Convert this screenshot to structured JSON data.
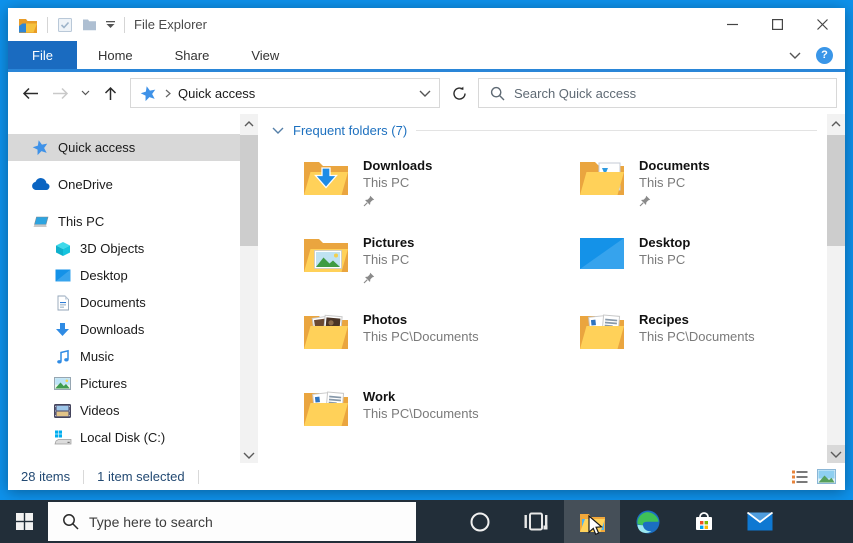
{
  "window": {
    "title": "File Explorer",
    "quick_access_toolbar": [
      "file-explorer-logo",
      "check-document",
      "folder-plain",
      "customize-caret"
    ],
    "controls": [
      "minimize",
      "maximize",
      "close"
    ]
  },
  "ribbon": {
    "tabs": [
      {
        "label": "File",
        "active": true
      },
      {
        "label": "Home",
        "active": false
      },
      {
        "label": "Share",
        "active": false
      },
      {
        "label": "View",
        "active": false
      }
    ],
    "help_label": "?"
  },
  "navbar": {
    "path_label": "Quick access",
    "search_placeholder": "Search Quick access"
  },
  "sidebar": {
    "items": [
      {
        "label": "Quick access",
        "icon": "star",
        "level": 0,
        "selected": true,
        "gap": false
      },
      {
        "label": "OneDrive",
        "icon": "onedrive",
        "level": 0,
        "selected": false,
        "gap": true
      },
      {
        "label": "This PC",
        "icon": "this-pc",
        "level": 0,
        "selected": false,
        "gap": true
      },
      {
        "label": "3D Objects",
        "icon": "cube",
        "level": 1,
        "selected": false,
        "gap": false
      },
      {
        "label": "Desktop",
        "icon": "desktop",
        "level": 1,
        "selected": false,
        "gap": false
      },
      {
        "label": "Documents",
        "icon": "document",
        "level": 1,
        "selected": false,
        "gap": false
      },
      {
        "label": "Downloads",
        "icon": "download-arrow",
        "level": 1,
        "selected": false,
        "gap": false
      },
      {
        "label": "Music",
        "icon": "music-note",
        "level": 1,
        "selected": false,
        "gap": false
      },
      {
        "label": "Pictures",
        "icon": "picture",
        "level": 1,
        "selected": false,
        "gap": false
      },
      {
        "label": "Videos",
        "icon": "film",
        "level": 1,
        "selected": false,
        "gap": false
      },
      {
        "label": "Local Disk (C:)",
        "icon": "disk",
        "level": 1,
        "selected": false,
        "gap": false
      }
    ]
  },
  "main": {
    "section_title": "Frequent folders (7)",
    "folders": [
      {
        "name": "Downloads",
        "location": "This PC",
        "icon": "tile-downloads",
        "pinned": true
      },
      {
        "name": "Documents",
        "location": "This PC",
        "icon": "tile-documents",
        "pinned": true
      },
      {
        "name": "Pictures",
        "location": "This PC",
        "icon": "tile-pictures",
        "pinned": true
      },
      {
        "name": "Desktop",
        "location": "This PC",
        "icon": "tile-desktop",
        "pinned": false
      },
      {
        "name": "Photos",
        "location": "This PC\\Documents",
        "icon": "tile-photos",
        "pinned": false
      },
      {
        "name": "Recipes",
        "location": "This PC\\Documents",
        "icon": "tile-docs",
        "pinned": false
      },
      {
        "name": "Work",
        "location": "This PC\\Documents",
        "icon": "tile-docs",
        "pinned": false
      }
    ]
  },
  "statusbar": {
    "items_count": "28 items",
    "selection": "1 item selected",
    "views": [
      "details-view",
      "thumbnail-view"
    ]
  },
  "taskbar": {
    "search_placeholder": "Type here to search",
    "apps": [
      {
        "name": "cortana",
        "active": false,
        "cursor": false
      },
      {
        "name": "task-view",
        "active": false,
        "cursor": false
      },
      {
        "name": "file-explorer",
        "active": true,
        "cursor": true
      },
      {
        "name": "edge",
        "active": false,
        "cursor": false
      },
      {
        "name": "store",
        "active": false,
        "cursor": false
      },
      {
        "name": "mail",
        "active": false,
        "cursor": false
      }
    ]
  },
  "colors": {
    "desktop": "#0e92ec",
    "file_tab": "#1a6bc0",
    "accent_line": "#2a86d8",
    "selection_gray": "#d8d8d8",
    "section_blue": "#1d70bf",
    "status_text": "#234a73",
    "taskbar_bg": "#222e39",
    "folder_yellow": "#ffd159"
  }
}
